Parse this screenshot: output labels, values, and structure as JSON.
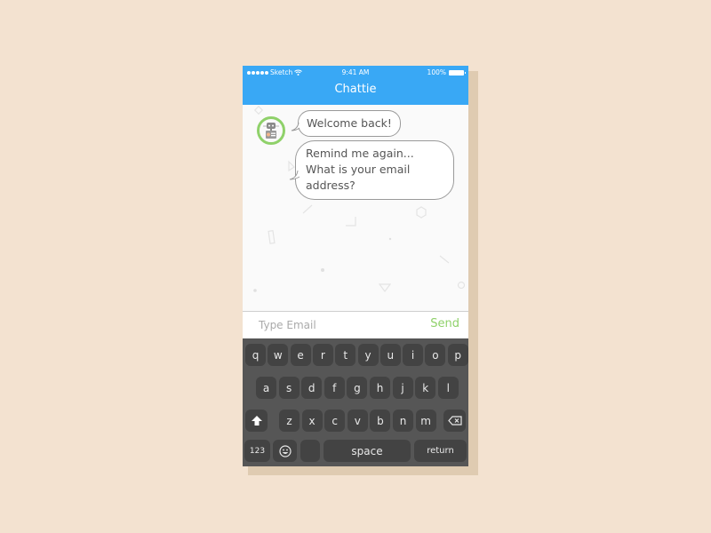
{
  "status_bar": {
    "carrier": "Sketch",
    "time": "9:41 AM",
    "battery": "100%"
  },
  "header": {
    "title": "Chattie"
  },
  "messages": [
    {
      "sender": "bot",
      "text": "Welcome back!"
    },
    {
      "sender": "bot",
      "lines": [
        "Remind me again...",
        "What is your email address?"
      ]
    }
  ],
  "input": {
    "placeholder": "Type Email",
    "send_label": "Send"
  },
  "keyboard": {
    "row1": [
      "q",
      "w",
      "e",
      "r",
      "t",
      "y",
      "u",
      "i",
      "o",
      "p"
    ],
    "row2": [
      "a",
      "s",
      "d",
      "f",
      "g",
      "h",
      "j",
      "k",
      "l"
    ],
    "row3": [
      "z",
      "x",
      "c",
      "v",
      "b",
      "n",
      "m"
    ],
    "numbers_label": "123",
    "space_label": "space",
    "return_label": "return"
  },
  "colors": {
    "accent": "#39a8f5",
    "send": "#8fd16a",
    "avatar_ring": "#8fd16a",
    "background": "#f3e2d0"
  }
}
